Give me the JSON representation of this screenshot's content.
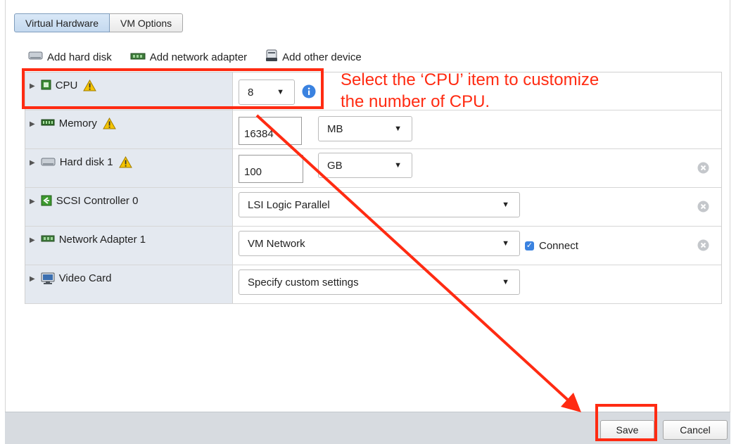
{
  "tabs": [
    {
      "label": "Virtual Hardware",
      "active": true
    },
    {
      "label": "VM Options",
      "active": false
    }
  ],
  "toolbar": {
    "add_hard_disk": "Add hard disk",
    "add_network_adapter": "Add network adapter",
    "add_other_device": "Add other device"
  },
  "devices": {
    "cpu": {
      "label": "CPU",
      "value": "8"
    },
    "memory": {
      "label": "Memory",
      "value": "16384",
      "unit": "MB"
    },
    "hard_disk": {
      "label": "Hard disk 1",
      "value": "100",
      "unit": "GB"
    },
    "scsi": {
      "label": "SCSI Controller 0",
      "value": "LSI Logic Parallel"
    },
    "network": {
      "label": "Network Adapter 1",
      "value": "VM Network",
      "connect_label": "Connect",
      "connect_checked": true
    },
    "video": {
      "label": "Video Card",
      "value": "Specify custom settings"
    }
  },
  "footer": {
    "save_label": "Save",
    "cancel_label": "Cancel"
  },
  "annotation": {
    "line1": "Select the ‘CPU’ item to customize",
    "line2": "the number of CPU.",
    "color": "#ff2b12"
  },
  "colors": {
    "label_column": "#e4e9f0",
    "footer": "#d7dbe0",
    "warning": "#f5c400",
    "info": "#3a82e0"
  }
}
